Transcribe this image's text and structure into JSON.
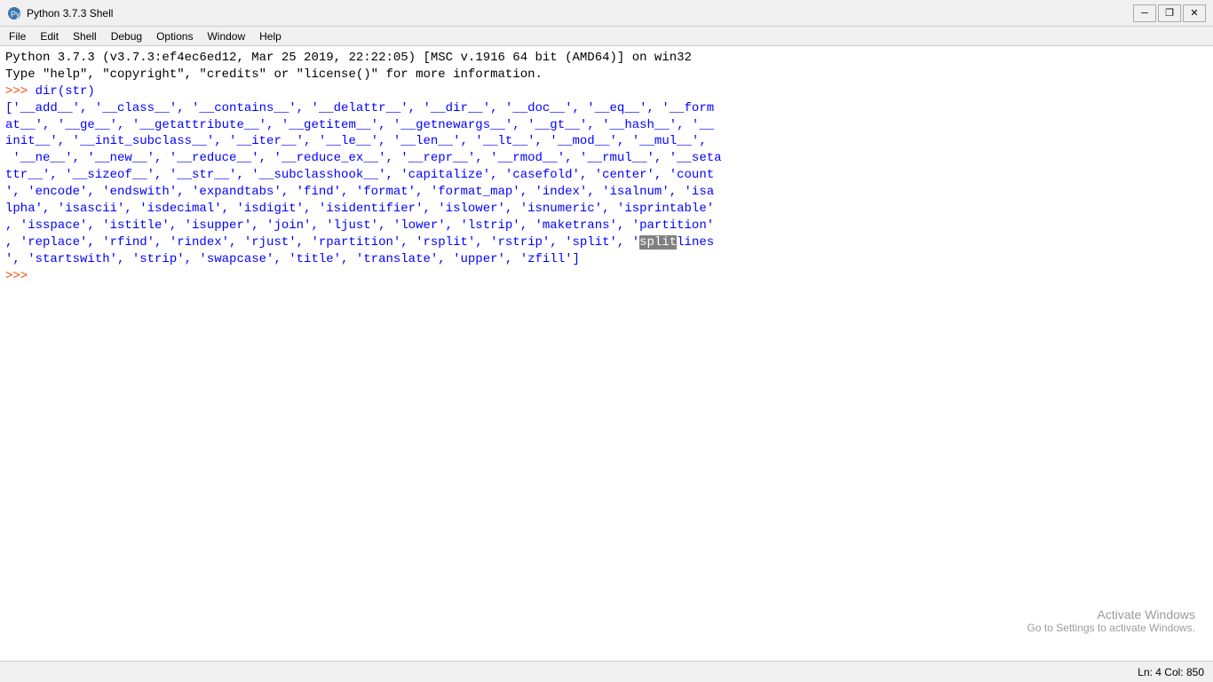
{
  "titlebar": {
    "icon": "python-icon",
    "title": "Python 3.7.3 Shell",
    "minimize_label": "─",
    "restore_label": "❐",
    "close_label": "✕"
  },
  "menubar": {
    "items": [
      "File",
      "Edit",
      "Shell",
      "Debug",
      "Options",
      "Window",
      "Help"
    ]
  },
  "shell": {
    "header_line1": "Python 3.7.3 (v3.7.3:ef4ec6ed12, Mar 25 2019, 22:22:05) [MSC v.1916 64 bit (AMD64)] on win32",
    "header_line2": "Type \"help\", \"copyright\", \"credits\" or \"license()\" for more information.",
    "prompt1": ">>> ",
    "command1": "dir(str)",
    "output_line1": "['__add__', '__class__', '__contains__', '__delattr__', '__dir__', '__doc__', '__eq__', '__form",
    "output_line2": "at__', '__ge__', '__getattribute__', '__getitem__', '__getnewargs__', '__gt__', '__hash__', '__",
    "output_line3": "init__', '__init_subclass__', '__iter__', '__le__', '__len__', '__lt__', '__mod__', '__mul__',",
    "output_line4": " '__ne__', '__new__', '__reduce__', '__reduce_ex__', '__repr__', '__rmod__', '__rmul__', '__seta",
    "output_line5": "ttr__', '__sizeof__', '__str__', '__subclasshook__', 'capitalize', 'casefold', 'center', 'count",
    "output_line6": "', 'encode', 'endswith', 'expandtabs', 'find', 'format', 'format_map', 'index', 'isalnum', 'isa",
    "output_line7": "lpha', 'isascii', 'isdecimal', 'isdigit', 'isidentifier', 'islower', 'isnumeric', 'isprintable'",
    "output_line8": ", 'isspace', 'istitle', 'isupper', 'join', 'ljust', 'lower', 'lstrip', 'maketrans', 'partition'",
    "output_line9": ", 'replace', 'rfind', 'rindex', 'rjust', 'rpartition', 'rsplit', 'rstrip', 'split', 'splitlines",
    "output_line9_highlight": "split",
    "output_line9_after": "lines",
    "output_line10": "', 'startswith', 'strip', 'swapcase', 'title', 'translate', 'upper', 'zfill']",
    "prompt2": ">>> ",
    "statusbar": {
      "position": "Ln: 4   Col: 850"
    }
  },
  "activate_windows": {
    "title": "Activate Windows",
    "subtitle": "Go to Settings to activate Windows."
  }
}
